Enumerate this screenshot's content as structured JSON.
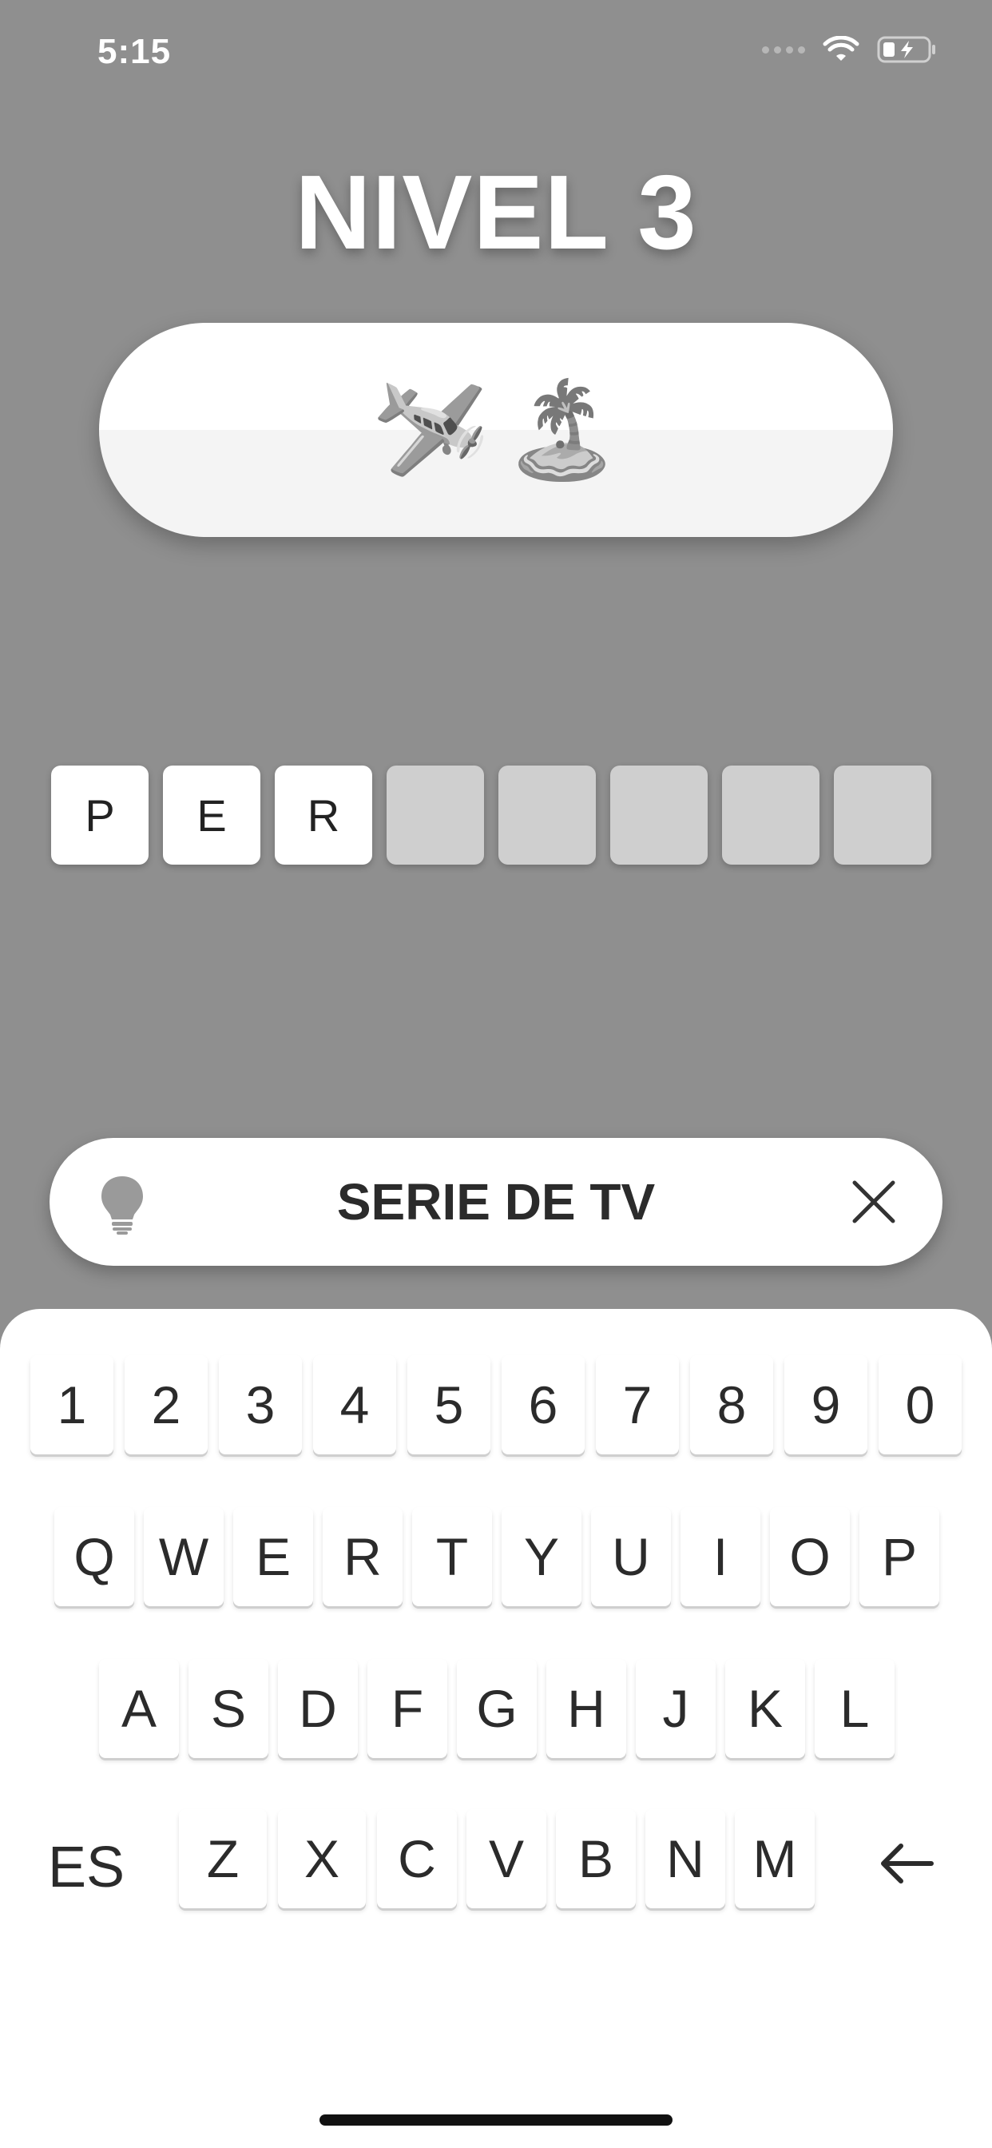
{
  "status_bar": {
    "time": "5:15",
    "icons": [
      "signal-dots-icon",
      "wifi-icon",
      "battery-charging-icon"
    ]
  },
  "level": {
    "title": "NIVEL 3"
  },
  "clue": {
    "emojis": [
      "🛩️",
      "🏝️"
    ]
  },
  "answer": {
    "letters": [
      "P",
      "E",
      "R",
      "",
      "",
      "",
      "",
      ""
    ]
  },
  "hint": {
    "icon": "lightbulb-icon",
    "label": "SERIE DE TV",
    "close_icon": "close-icon"
  },
  "keyboard": {
    "rows": [
      [
        "1",
        "2",
        "3",
        "4",
        "5",
        "6",
        "7",
        "8",
        "9",
        "0"
      ],
      [
        "Q",
        "W",
        "E",
        "R",
        "T",
        "Y",
        "U",
        "I",
        "O",
        "P"
      ],
      [
        "A",
        "S",
        "D",
        "F",
        "G",
        "H",
        "J",
        "K",
        "L"
      ],
      [
        "Z",
        "X",
        "C",
        "V",
        "B",
        "N",
        "M"
      ]
    ],
    "language_label": "ES",
    "backspace_icon": "backspace-arrow-icon"
  },
  "colors": {
    "background": "#8f8f8f",
    "empty_slot": "#cfcfcf",
    "text": "#2b2b2b"
  }
}
